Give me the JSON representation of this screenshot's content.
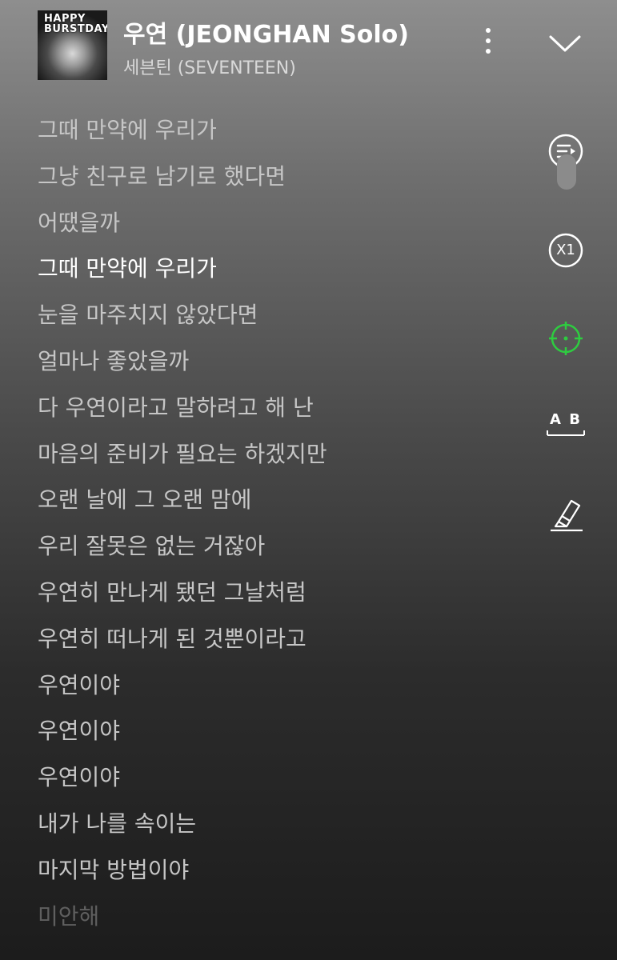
{
  "header": {
    "album_art_text": "HAPPY BURSTDAY",
    "title": "우연 (JEONGHAN Solo)",
    "artist": "세븐틴 (SEVENTEEN)"
  },
  "tools": {
    "speed_label": "X1",
    "translate_label": "A B"
  },
  "colors": {
    "accent": "#2ecc40",
    "active_lyric": "#ffffff",
    "inactive_lyric": "#c6c6c6"
  },
  "lyrics": [
    "그때 만약에 우리가",
    "그냥 친구로 남기로 했다면",
    "어땠을까",
    "그때 만약에 우리가",
    "눈을 마주치지 않았다면",
    "얼마나 좋았을까",
    "다 우연이라고 말하려고 해 난",
    "마음의 준비가 필요는 하겠지만",
    "오랜 날에 그 오랜 맘에",
    "우리 잘못은 없는 거잖아",
    "우연히 만나게 됐던 그날처럼",
    "우연히 떠나게 된 것뿐이라고",
    "우연이야",
    "우연이야",
    "우연이야",
    "내가 나를 속이는",
    "마지막 방법이야",
    "미안해"
  ]
}
